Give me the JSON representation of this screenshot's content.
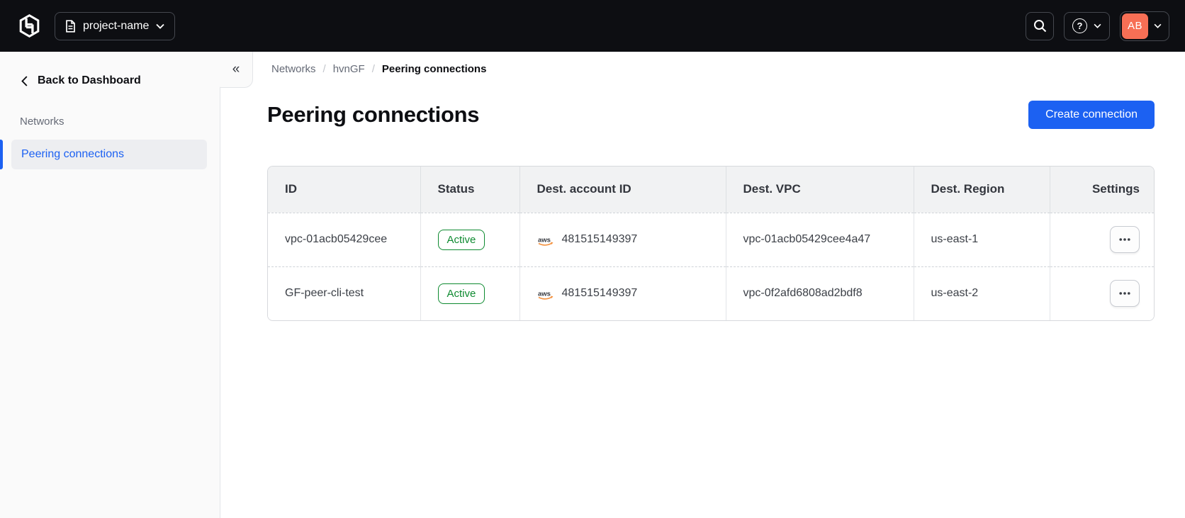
{
  "topbar": {
    "project_label": "project-name",
    "avatar_initials": "AB"
  },
  "sidebar": {
    "back_label": "Back to Dashboard",
    "section_label": "Networks",
    "items": [
      {
        "label": "Peering connections",
        "active": true
      }
    ]
  },
  "breadcrumb": {
    "items": [
      "Networks",
      "hvnGF",
      "Peering connections"
    ],
    "separator": "/"
  },
  "page": {
    "title": "Peering connections",
    "create_button_label": "Create connection"
  },
  "table": {
    "columns": [
      "ID",
      "Status",
      "Dest. account ID",
      "Dest. VPC",
      "Dest. Region",
      "Settings"
    ],
    "rows": [
      {
        "id": "vpc-01acb05429cee",
        "status": "Active",
        "dest_account_id": "481515149397",
        "dest_vpc": "vpc-01acb05429cee4a47",
        "dest_region": "us-east-1"
      },
      {
        "id": "GF-peer-cli-test",
        "status": "Active",
        "dest_account_id": "481515149397",
        "dest_vpc": "vpc-0f2afd6808ad2bdf8",
        "dest_region": "us-east-2"
      }
    ]
  },
  "icons": {
    "collapse": "«",
    "help": "?",
    "aws_label": "aws"
  },
  "colors": {
    "topbar_black": "#0D0E12",
    "accent_blue": "#1C61F2",
    "success_green": "#0E8A30",
    "avatar_orange": "#F76F55",
    "sidebar_gray": "#FAFAFA",
    "header_row_gray": "#F1F2F3"
  }
}
